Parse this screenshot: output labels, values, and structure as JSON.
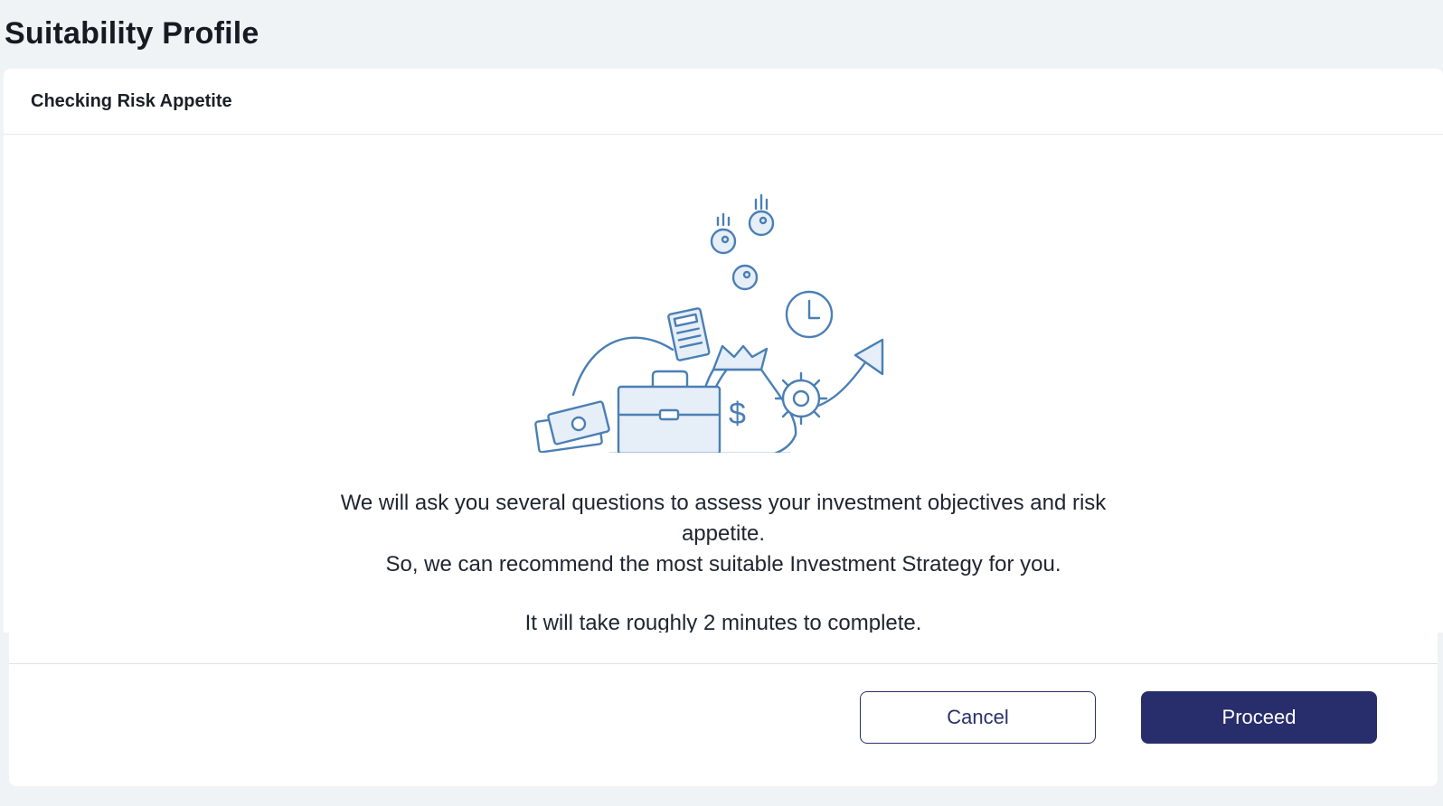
{
  "page": {
    "title": "Suitability Profile"
  },
  "card": {
    "header_title": "Checking Risk Appetite",
    "illustration_icon": "investment-moneybag-illustration",
    "message_line_1": "We will ask you several questions to assess your investment objectives and risk appetite.",
    "message_line_2": "So, we can recommend the most suitable Investment Strategy for you.",
    "message_line_3": "It will take roughly 2 minutes to complete."
  },
  "footer": {
    "cancel_label": "Cancel",
    "proceed_label": "Proceed"
  },
  "colors": {
    "primary": "#282d6b",
    "illustration_stroke": "#4a7fb5",
    "illustration_fill": "#e6eef7",
    "background": "#f0f3f6"
  }
}
